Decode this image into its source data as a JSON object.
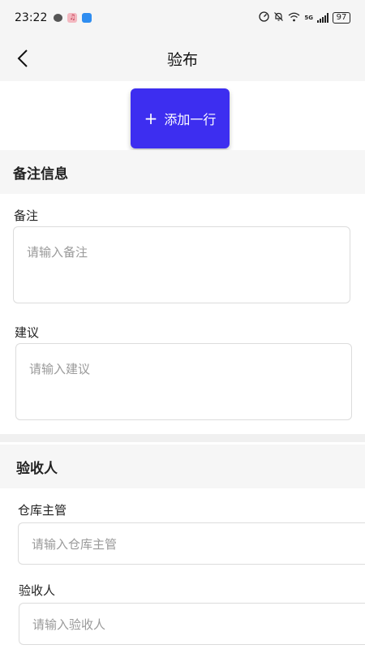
{
  "status_bar": {
    "time": "23:22",
    "network": "5G",
    "battery": "97"
  },
  "nav": {
    "title": "验布"
  },
  "actions": {
    "add_row_label": "添加一行"
  },
  "remarks_section": {
    "title": "备注信息",
    "remark_label": "备注",
    "remark_placeholder": "请输入备注",
    "suggestion_label": "建议",
    "suggestion_placeholder": "请输入建议"
  },
  "acceptor_section": {
    "title": "验收人",
    "warehouse_label": "仓库主管",
    "warehouse_placeholder": "请输入仓库主管",
    "acceptor_label": "验收人",
    "acceptor_placeholder": "请输入验收人"
  },
  "colors": {
    "accent": "#3d2ef0",
    "header_bg": "#f5f5f5",
    "placeholder": "#9a9a9a"
  },
  "icons": [
    "wechat-icon",
    "music-icon",
    "cloud-icon",
    "speed-icon",
    "mute-bell-icon",
    "wifi-icon",
    "signal-icon",
    "battery-icon",
    "back-arrow-icon",
    "plus-icon"
  ]
}
